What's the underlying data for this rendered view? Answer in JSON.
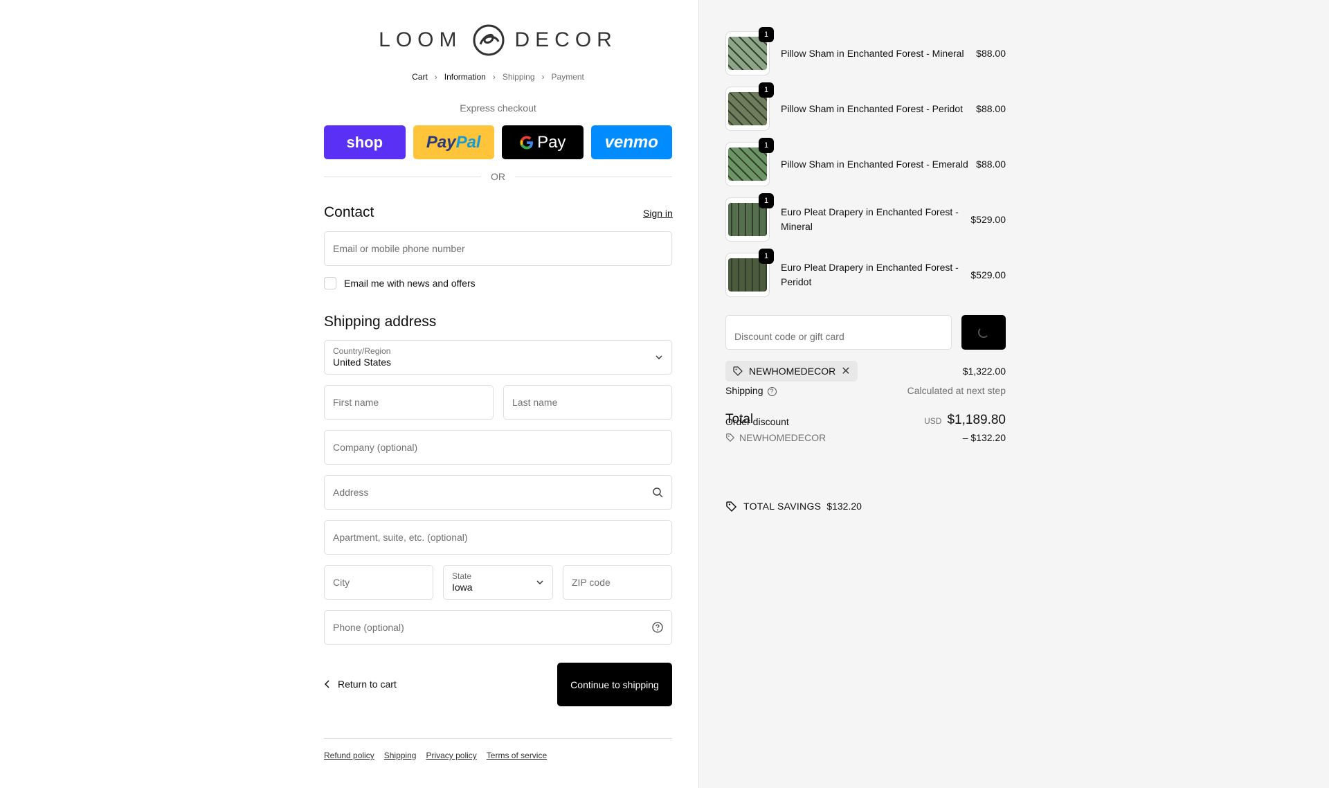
{
  "logo": {
    "left": "LOOM",
    "right": "DECOR"
  },
  "breadcrumb": {
    "cart": "Cart",
    "information": "Information",
    "shipping": "Shipping",
    "payment": "Payment"
  },
  "express": {
    "title": "Express checkout",
    "shop": "shop",
    "paypal_a": "Pay",
    "paypal_b": "Pal",
    "gpay": "Pay",
    "venmo": "venmo",
    "or": "OR"
  },
  "contact": {
    "title": "Contact",
    "signin": "Sign in",
    "email_placeholder": "Email or mobile phone number",
    "news_label": "Email me with news and offers"
  },
  "shipping_address": {
    "title": "Shipping address",
    "country_label": "Country/Region",
    "country_value": "United States",
    "first_name": "First name",
    "last_name": "Last name",
    "company": "Company (optional)",
    "address": "Address",
    "apartment": "Apartment, suite, etc. (optional)",
    "city": "City",
    "state_label": "State",
    "state_value": "Iowa",
    "zip": "ZIP code",
    "phone": "Phone (optional)"
  },
  "actions": {
    "return": "Return to cart",
    "continue": "Continue to shipping"
  },
  "footer": {
    "refund": "Refund policy",
    "shipping": "Shipping",
    "privacy": "Privacy policy",
    "terms": "Terms of service"
  },
  "items": [
    {
      "name": "Pillow Sham in Enchanted Forest - Mineral",
      "price": "$88.00",
      "qty": "1",
      "color": "#8fa58a"
    },
    {
      "name": "Pillow Sham in Enchanted Forest - Peridot",
      "price": "$88.00",
      "qty": "1",
      "color": "#6f7d5c"
    },
    {
      "name": "Pillow Sham in Enchanted Forest - Emerald",
      "price": "$88.00",
      "qty": "1",
      "color": "#6c9466"
    },
    {
      "name": "Euro Pleat Drapery in Enchanted Forest - Mineral",
      "price": "$529.00",
      "qty": "1",
      "color": "#56704f"
    },
    {
      "name": "Euro Pleat Drapery in Enchanted Forest - Peridot",
      "price": "$529.00",
      "qty": "1",
      "color": "#4c5a3e"
    }
  ],
  "discount": {
    "placeholder": "Discount code or gift card",
    "code": "NEWHOMEDECOR"
  },
  "summary": {
    "subtotal": "$1,322.00",
    "shipping_label": "Shipping",
    "shipping_value": "Calculated at next step",
    "total_label": "Total",
    "order_discount_label": "Order discount",
    "currency": "USD",
    "total": "$1,189.80",
    "discount_code": "NEWHOMEDECOR",
    "discount_amount": "– $132.20",
    "savings_label": "TOTAL SAVINGS",
    "savings_value": "$132.20"
  }
}
